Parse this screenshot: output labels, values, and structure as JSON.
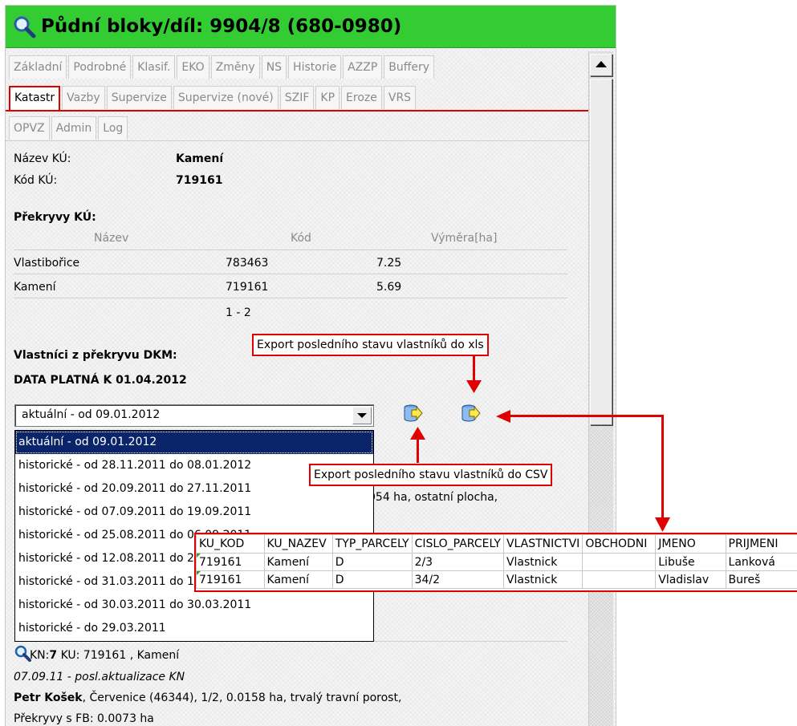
{
  "window": {
    "title": "Půdní bloky/díl: 9904/8 (680-0980)"
  },
  "tabs": {
    "row1": [
      "Základní",
      "Podrobné",
      "Klasif.",
      "EKO",
      "Změny",
      "NS",
      "Historie",
      "AZZP",
      "Buffery"
    ],
    "row2": [
      "Katastr",
      "Vazby",
      "Supervize",
      "Supervize (nové)",
      "SZIF",
      "KP",
      "Eroze",
      "VRS"
    ],
    "row3": [
      "OPVZ",
      "Admin",
      "Log"
    ],
    "active": "Katastr"
  },
  "ku": {
    "name_label": "Název KÚ:",
    "name_value": "Kamení",
    "code_label": "Kód KÚ:",
    "code_value": "719161"
  },
  "overlaps": {
    "heading": "Překryvy KÚ:",
    "columns": [
      "Název",
      "Kód",
      "Výměra[ha]"
    ],
    "rows": [
      {
        "name": "Vlastibořice",
        "code": "783463",
        "area": "7.25"
      },
      {
        "name": "Kamení",
        "code": "719161",
        "area": "5.69"
      }
    ],
    "pager": "1 - 2"
  },
  "owners": {
    "heading": "Vlastníci z překryvu DKM:",
    "valid_date": "DATA PLATNÁ K 01.04.2012",
    "select_value": "aktuální - od 09.01.2012",
    "options": [
      "aktuální - od 09.01.2012",
      "historické - od 28.11.2011 do 08.01.2012",
      "historické - od 20.09.2011 do 27.11.2011",
      "historické - od 07.09.2011 do 19.09.2011",
      "historické - od 25.08.2011 do 06.09.2011",
      "historické - od 12.08.2011 do 24.08.2011",
      "historické - od 31.03.2011 do 11.08.2011",
      "historické - od 30.03.2011 do 30.03.2011",
      "historické - do 29.03.2011"
    ],
    "partial_behind": "054 ha, ostatní plocha,"
  },
  "callouts": {
    "xls": "Export posledního stavu vlastníků do xls",
    "csv": "Export posledního stavu vlastníků do CSV"
  },
  "export_table": {
    "columns": [
      "KU_KOD",
      "KU_NAZEV",
      "TYP_PARCELY",
      "CISLO_PARCELY",
      "VLASTNICTVI",
      "OBCHODNI",
      "JMENO",
      "PRIJMENI"
    ],
    "rows": [
      [
        "719161",
        "Kamení",
        "D",
        "2/3",
        "Vlastnick",
        "",
        "Libuše",
        "Lanková"
      ],
      [
        "719161",
        "Kamení",
        "D",
        "34/2",
        "Vlastnick",
        "",
        "Vladislav",
        "Bureš"
      ]
    ]
  },
  "kn": {
    "line": "KN:7 KU: 719161 , Kamení",
    "kn_prefix": "KN:",
    "kn_num": "7",
    "kn_rest": " KU: 719161 , Kamení",
    "update": "07.09.11 - posl.aktualizace KN",
    "owner_name": "Petr Košek",
    "owner_rest": ", Červenice (46344), 1/2, 0.0158 ha, trvalý travní porost,",
    "fb_overlap": "Překryvy s FB: 0.0073 ha"
  },
  "colors": {
    "title_bg": "#33cc33",
    "accent": "#e00000",
    "selection": "#0a246a"
  }
}
